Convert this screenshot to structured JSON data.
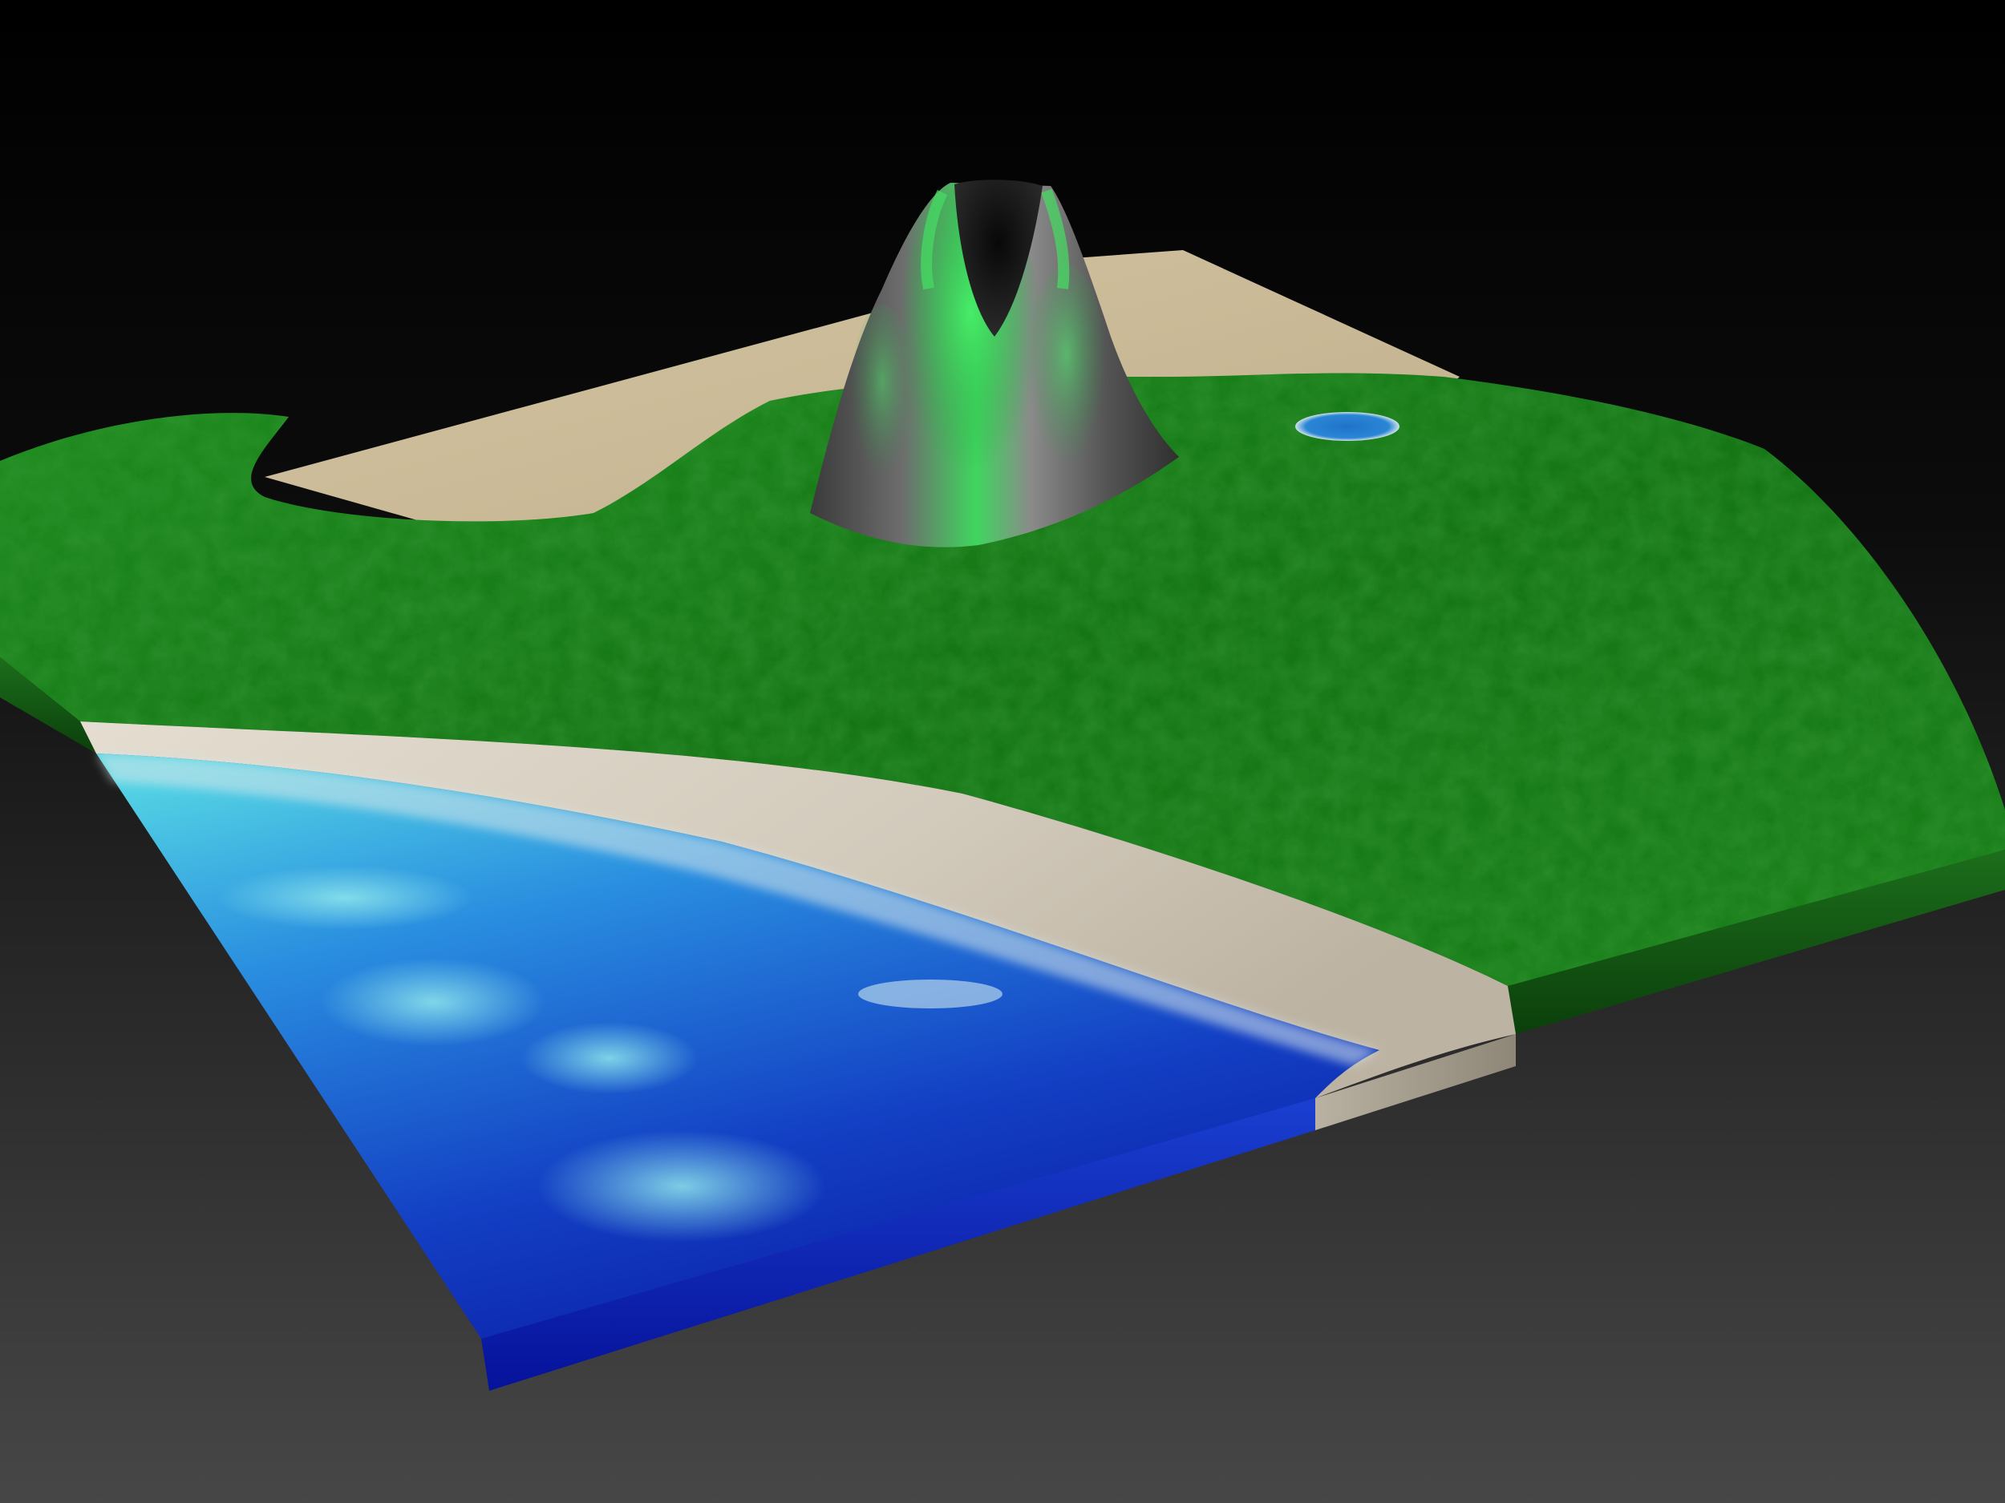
{
  "scene": {
    "subject": "",
    "colors": {
      "background_top": "#000000",
      "background_bottom": "#474747",
      "sand": "#cbbd9c",
      "beach": "#d6cfc2",
      "grass_dark": "#0d5a0d",
      "grass_mid": "#1f8a1f",
      "grass_light": "#3cb83c",
      "rock_dark": "#2a2a2a",
      "rock_mid": "#6b6b6b",
      "moss": "#39d95a",
      "water_deep": "#0b1fb0",
      "water_mid": "#1a63d6",
      "water_shallow": "#4fd0e0",
      "water_side": "#0a1a9a",
      "pond": "#1e73c9"
    },
    "icons": {
      "volcano": "volcano-icon",
      "pond": "pond-icon"
    }
  }
}
